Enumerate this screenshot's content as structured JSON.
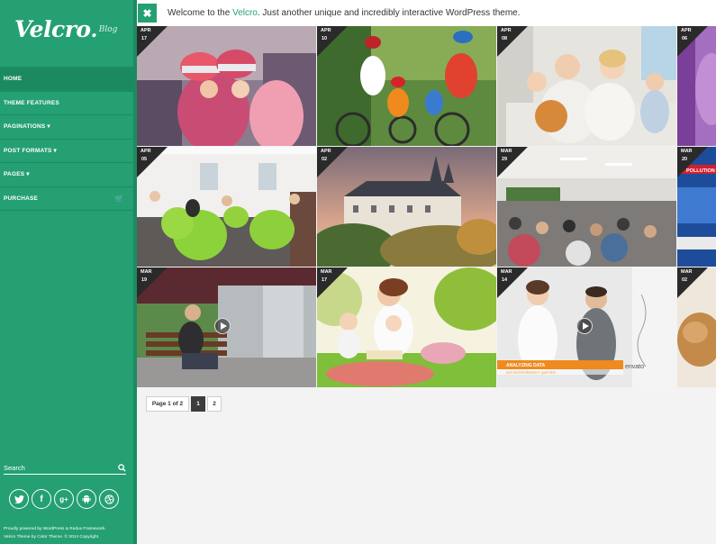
{
  "logo": {
    "main": "Velcro",
    "sub": "Blog"
  },
  "nav": [
    {
      "label": "HOME",
      "active": true
    },
    {
      "label": "THEME FEATURES",
      "active": false
    },
    {
      "label": "PAGINATIONS ▾",
      "active": false
    },
    {
      "label": "POST FORMATS ▾",
      "active": false
    },
    {
      "label": "PAGES ▾",
      "active": false
    },
    {
      "label": "PURCHASE",
      "active": false
    }
  ],
  "search": {
    "placeholder": "Search"
  },
  "socials": [
    "twitter",
    "facebook",
    "google-plus",
    "android",
    "dribbble"
  ],
  "footer": {
    "line1": "Proudly powered by WordPress & Redux Framework.",
    "line2": "Velcro Theme by Color Theme. © 2014 Copyright."
  },
  "topbar": {
    "close": "✖",
    "prefix": "Welcome to the ",
    "brand": "Velcro",
    "suffix": ". Just another unique and incredibly interactive WordPress theme."
  },
  "posts": [
    {
      "month": "APR",
      "day": "17"
    },
    {
      "month": "APR",
      "day": "10"
    },
    {
      "month": "APR",
      "day": "08"
    },
    {
      "month": "APR",
      "day": "06"
    },
    {
      "month": "APR",
      "day": "05"
    },
    {
      "month": "APR",
      "day": "02"
    },
    {
      "month": "MAR",
      "day": "29"
    },
    {
      "month": "MAR",
      "day": "20"
    },
    {
      "month": "MAR",
      "day": "19"
    },
    {
      "month": "MAR",
      "day": "17"
    },
    {
      "month": "MAR",
      "day": "14"
    },
    {
      "month": "MAR",
      "day": "02"
    }
  ],
  "tile_texts": {
    "pollution": "POLLUTION",
    "analyzing": "ANALYZING DATA",
    "analyzing_sub": "your second description goes here",
    "envato": "envato"
  },
  "pagination": {
    "info": "Page 1 of 2",
    "pages": [
      "1",
      "2"
    ],
    "current": "1"
  },
  "colors": {
    "accent": "#24a072",
    "sidebar": "#24a072"
  }
}
